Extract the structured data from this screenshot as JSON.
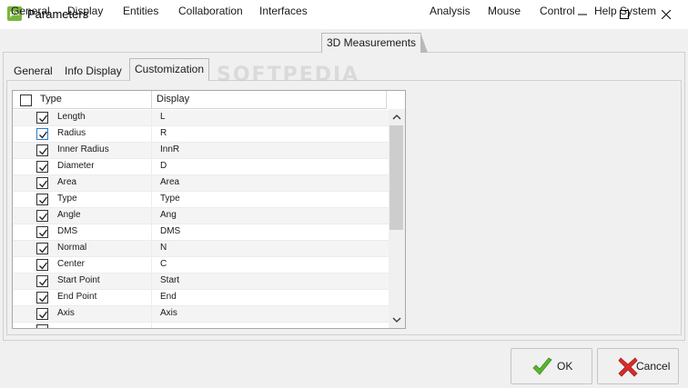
{
  "window": {
    "title": "Parameters",
    "app_icon_text": "px"
  },
  "outer_tabs": [
    {
      "label": "General"
    },
    {
      "label": "Display"
    },
    {
      "label": "Entities"
    },
    {
      "label": "Collaboration"
    },
    {
      "label": "Interfaces"
    },
    {
      "label": "3D Measurements",
      "active": true
    },
    {
      "label": "Analysis"
    },
    {
      "label": "Mouse"
    },
    {
      "label": "Control"
    },
    {
      "label": "Help System"
    }
  ],
  "inner_tabs": [
    {
      "label": "General"
    },
    {
      "label": "Info Display"
    },
    {
      "label": "Customization",
      "active": true
    }
  ],
  "grid": {
    "header": {
      "type": "Type",
      "display": "Display",
      "select_all_checked": false
    },
    "rows": [
      {
        "type": "Length",
        "display": "L",
        "checked": true
      },
      {
        "type": "Radius",
        "display": "R",
        "checked": true
      },
      {
        "type": "Inner Radius",
        "display": "InnR",
        "checked": true
      },
      {
        "type": "Diameter",
        "display": "D",
        "checked": true
      },
      {
        "type": "Area",
        "display": "Area",
        "checked": true
      },
      {
        "type": "Type",
        "display": "Type",
        "checked": true
      },
      {
        "type": "Angle",
        "display": "Ang",
        "checked": true
      },
      {
        "type": "DMS",
        "display": "DMS",
        "checked": true
      },
      {
        "type": "Normal",
        "display": "N",
        "checked": true
      },
      {
        "type": "Center",
        "display": "C",
        "checked": true
      },
      {
        "type": "Start Point",
        "display": "Start",
        "checked": true
      },
      {
        "type": "End Point",
        "display": "End",
        "checked": true
      },
      {
        "type": "Axis",
        "display": "Axis",
        "checked": true
      },
      {
        "type": "",
        "display": "",
        "checked": true
      }
    ]
  },
  "buttons": {
    "ok": "OK",
    "cancel": "Cancel"
  },
  "watermark": "SOFTPEDIA",
  "colors": {
    "accent_check": "#2a78d0",
    "ok_icon": "#5cb531",
    "cancel_icon": "#d62b2b",
    "app_icon": "#7ab540"
  }
}
